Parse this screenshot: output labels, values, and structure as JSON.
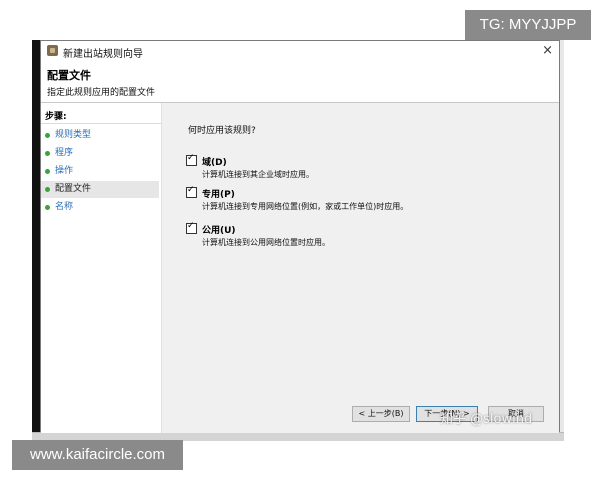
{
  "window": {
    "title": "新建出站规则向导",
    "close_glyph": "×",
    "icon": "wizard-app-icon"
  },
  "header": {
    "title": "配置文件",
    "subtitle": "指定此规则应用的配置文件"
  },
  "sidebar": {
    "steps_label": "步骤:",
    "items": [
      {
        "label": "规则类型",
        "active": false
      },
      {
        "label": "程序",
        "active": false
      },
      {
        "label": "操作",
        "active": false
      },
      {
        "label": "配置文件",
        "active": true
      },
      {
        "label": "名称",
        "active": false
      }
    ]
  },
  "content": {
    "question": "何时应用该规则?",
    "options": [
      {
        "label": "域(D)",
        "checked": true,
        "description": "计算机连接到其企业域时应用。"
      },
      {
        "label": "专用(P)",
        "checked": true,
        "description": "计算机连接到专用网络位置(例如，家或工作单位)时应用。"
      },
      {
        "label": "公用(U)",
        "checked": true,
        "description": "计算机连接到公用网络位置时应用。"
      }
    ]
  },
  "buttons": {
    "back": "< 上一步(B)",
    "next": "下一步(N) >",
    "cancel": "取消"
  },
  "watermarks": {
    "top_right": "TG: MYYJJPP",
    "bottom_left": "www.kaifacircle.com",
    "overlay": "知乎 @slowind"
  },
  "colors": {
    "step_link": "#2a6db5",
    "step_bullet": "#3ba33b",
    "content_bg": "#f0f0f0"
  }
}
